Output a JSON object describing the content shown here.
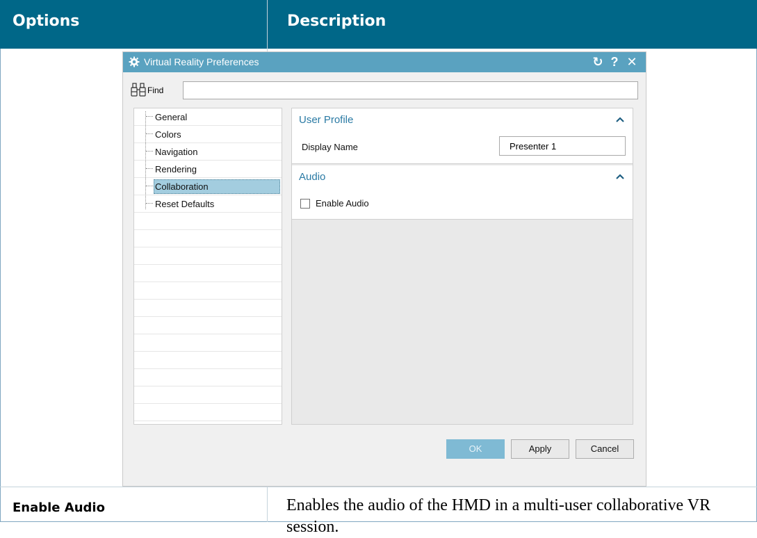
{
  "table": {
    "header_options": "Options",
    "header_description": "Description",
    "row_option": "Enable Audio",
    "row_description": "Enables the audio of the HMD in a multi-user collaborative VR session."
  },
  "dialog": {
    "title": "Virtual Reality Preferences",
    "titlebar_icons": [
      "gear-icon",
      "reset-icon",
      "help-icon",
      "close-icon"
    ],
    "reset_glyph": "↻",
    "help_glyph": "?",
    "close_glyph": "✕",
    "find": {
      "label": "Find",
      "icon": "binoculars-icon",
      "value": ""
    },
    "tree": {
      "items": [
        {
          "label": "General",
          "selected": false
        },
        {
          "label": "Colors",
          "selected": false
        },
        {
          "label": "Navigation",
          "selected": false
        },
        {
          "label": "Rendering",
          "selected": false
        },
        {
          "label": "Collaboration",
          "selected": true
        },
        {
          "label": "Reset Defaults",
          "selected": false
        }
      ]
    },
    "sections": {
      "user_profile": {
        "title": "User Profile",
        "display_name_label": "Display Name",
        "display_name_value": "Presenter 1"
      },
      "audio": {
        "title": "Audio",
        "enable_audio_label": "Enable Audio",
        "enable_audio_checked": false
      }
    },
    "buttons": {
      "ok": "OK",
      "apply": "Apply",
      "cancel": "Cancel"
    }
  },
  "colors": {
    "table_header": "#006788",
    "titlebar": "#5aa2c0",
    "accent_text": "#2a7aa4",
    "selection": "#a3cddf",
    "ok_button": "#7fbad4"
  }
}
